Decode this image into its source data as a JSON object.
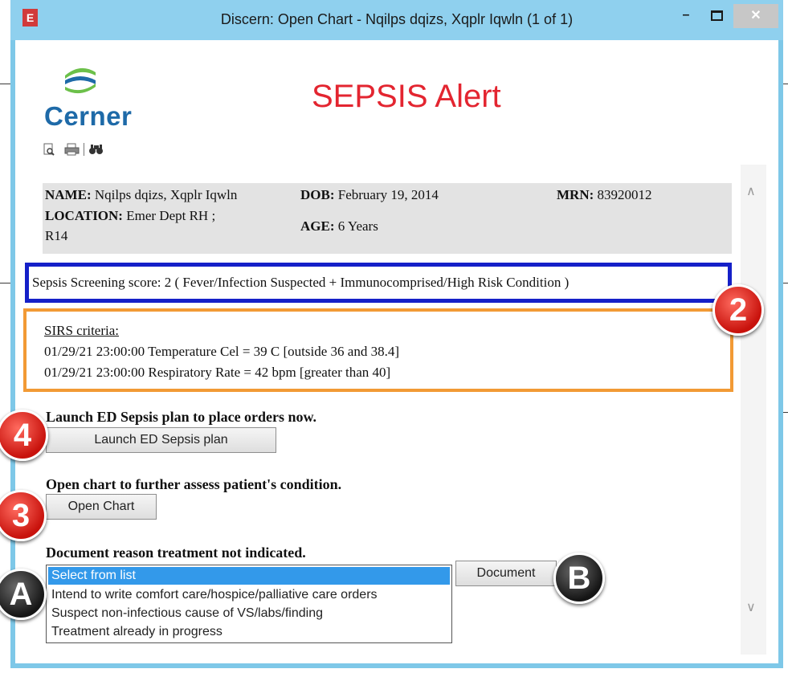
{
  "window": {
    "app_icon": "E",
    "title": "Discern: Open Chart - Nqilps dqizs, Xqplr Iqwln (1 of 1)",
    "minimize": "–",
    "close": "✕"
  },
  "header": {
    "logo_text": "Cerner",
    "alert_title": "SEPSIS Alert",
    "tools": [
      "preview-icon",
      "print-icon",
      "find-icon"
    ]
  },
  "patient": {
    "name_label": "NAME:",
    "name_value": "Nqilps dqizs, Xqplr Iqwln",
    "dob_label": "DOB:",
    "dob_value": "February 19, 2014",
    "mrn_label": "MRN:",
    "mrn_value": "83920012",
    "location_label": "LOCATION:",
    "location_value_1": "Emer Dept RH ;",
    "location_value_2": "R14",
    "age_label": "AGE:",
    "age_value": "6 Years"
  },
  "screening": {
    "score_text": "Sepsis Screening score: 2 ( Fever/Infection Suspected + Immunocomprised/High Risk Condition )"
  },
  "sirs": {
    "heading": "SIRS criteria:",
    "lines": [
      "01/29/21 23:00:00 Temperature Cel = 39 C [outside 36 and 38.4]",
      "01/29/21 23:00:00 Respiratory Rate = 42 bpm [greater than 40]"
    ]
  },
  "launch": {
    "heading": "Launch ED Sepsis plan to place orders now.",
    "button": "Launch ED Sepsis plan"
  },
  "open_chart": {
    "heading": "Open chart to further assess patient's condition.",
    "button": "Open Chart"
  },
  "document": {
    "heading": "Document reason treatment not indicated.",
    "options": [
      "Select from list",
      "Intend to write comfort care/hospice/palliative care orders",
      "Suspect non-infectious cause of VS/labs/finding",
      "Treatment already in progress"
    ],
    "selected_index": 0,
    "button": "Document"
  },
  "callouts": [
    "2",
    "4",
    "3",
    "A",
    "B"
  ],
  "colors": {
    "title_bar": "#8fd0ee",
    "alert_red": "#e32530",
    "score_border": "#1520c8",
    "sirs_border": "#f29a35",
    "selection": "#3399ea",
    "logo_blue": "#1e6aa8",
    "logo_green": "#6cc04a"
  }
}
